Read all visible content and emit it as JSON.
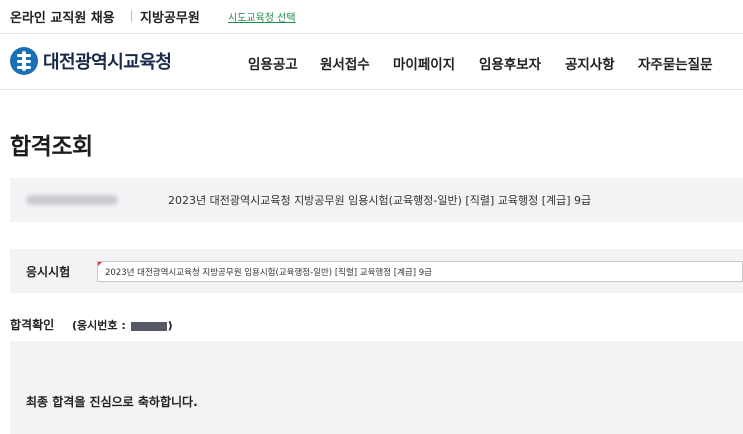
{
  "topbar": {
    "links": [
      "온라인 교직원 채용",
      "지방공무원"
    ],
    "select_label": "시도교육청 선택"
  },
  "header": {
    "logo_text": "대전광역시교육청",
    "nav": [
      "임용공고",
      "원서접수",
      "마이페이지",
      "임용후보자",
      "공지사항",
      "자주묻는질문"
    ]
  },
  "page": {
    "title": "합격조회"
  },
  "exam_info": {
    "exam_name": "2023년 대전광역시교육청 지방공무원 임용시험(교육행정-일반) [직렬] 교육행정 [계급] 9급"
  },
  "exam_select": {
    "label": "응시시험",
    "value": "2023년 대전광역시교육청 지방공무원 임용시험(교육행정-일반) [직렬] 교육행정 [계급] 9급"
  },
  "confirm": {
    "label": "합격확인",
    "applicant_prefix": "(응시번호 :",
    "applicant_suffix": ")",
    "message": "최종 합격을 진심으로 축하합니다."
  },
  "colors": {
    "accent_green": "#1f8a4c",
    "logo_blue": "#1a6fb5",
    "panel_gray": "#f2f3f5"
  }
}
